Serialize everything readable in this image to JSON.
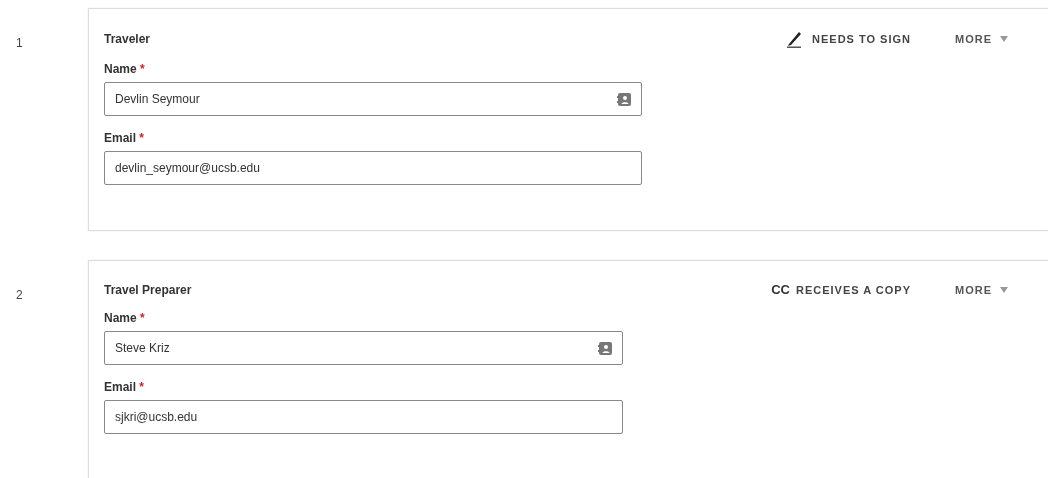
{
  "recipients": [
    {
      "number": "1",
      "role": "Traveler",
      "action": {
        "kind": "sign",
        "label": "NEEDS TO SIGN"
      },
      "more": "MORE",
      "fields": [
        {
          "label": "Name",
          "required_mark": "*",
          "value": "Devlin Seymour",
          "kind": "contact"
        },
        {
          "label": "Email",
          "required_mark": "*",
          "value": "devlin_seymour@ucsb.edu",
          "kind": "text"
        }
      ]
    },
    {
      "number": "2",
      "role": "Travel Preparer",
      "action": {
        "kind": "cc",
        "badge": "CC",
        "label": "RECEIVES A COPY"
      },
      "more": "MORE",
      "fields": [
        {
          "label": "Name",
          "required_mark": "*",
          "value": "Steve Kriz",
          "kind": "contact"
        },
        {
          "label": "Email",
          "required_mark": "*",
          "value": "sjkri@ucsb.edu",
          "kind": "text"
        }
      ]
    }
  ]
}
